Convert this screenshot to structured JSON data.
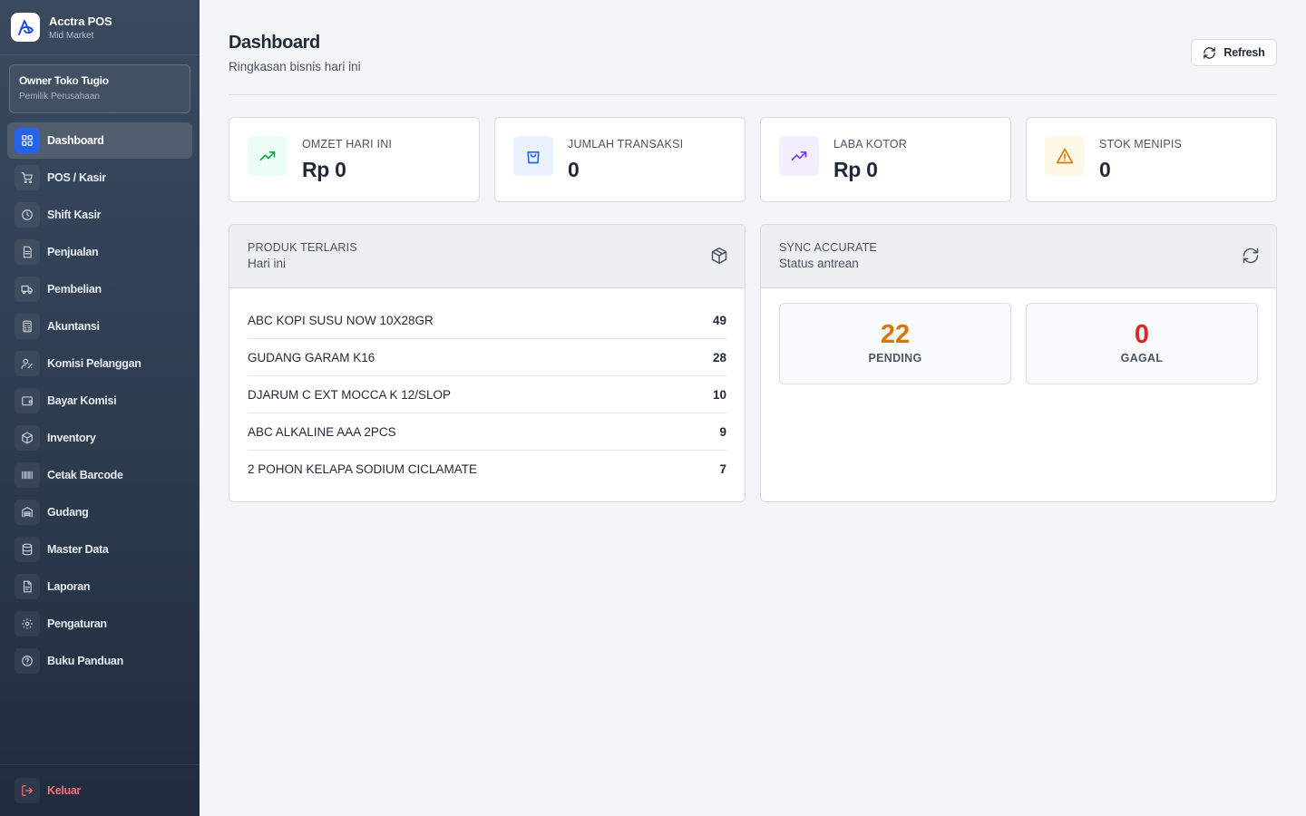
{
  "app": {
    "name": "Acctra POS",
    "plan": "Mid Market"
  },
  "user": {
    "name": "Owner Toko Tugio",
    "role": "Pemilik Perusahaan"
  },
  "sidebar": {
    "items": [
      {
        "label": "Dashboard",
        "icon": "grid-icon"
      },
      {
        "label": "POS / Kasir",
        "icon": "cart-icon"
      },
      {
        "label": "Shift Kasir",
        "icon": "clock-icon"
      },
      {
        "label": "Penjualan",
        "icon": "receipt-icon"
      },
      {
        "label": "Pembelian",
        "icon": "truck-icon"
      },
      {
        "label": "Akuntansi",
        "icon": "calculator-icon"
      },
      {
        "label": "Komisi Pelanggan",
        "icon": "user-commission-icon"
      },
      {
        "label": "Bayar Komisi",
        "icon": "wallet-icon"
      },
      {
        "label": "Inventory",
        "icon": "box-icon"
      },
      {
        "label": "Cetak Barcode",
        "icon": "barcode-icon"
      },
      {
        "label": "Gudang",
        "icon": "warehouse-icon"
      },
      {
        "label": "Master Data",
        "icon": "database-icon"
      },
      {
        "label": "Laporan",
        "icon": "report-icon"
      },
      {
        "label": "Pengaturan",
        "icon": "gear-icon"
      },
      {
        "label": "Buku Panduan",
        "icon": "help-icon"
      }
    ],
    "logout_label": "Keluar"
  },
  "header": {
    "title": "Dashboard",
    "subtitle": "Ringkasan bisnis hari ini",
    "refresh_label": "Refresh"
  },
  "stats": [
    {
      "label": "OMZET HARI INI",
      "value": "Rp 0",
      "icon": "trending-up-icon",
      "color": "#16a34a",
      "bg": "#ecfdf3"
    },
    {
      "label": "JUMLAH TRANSAKSI",
      "value": "0",
      "icon": "shopping-bag-icon",
      "color": "#2563eb",
      "bg": "#eaf2ff"
    },
    {
      "label": "LABA KOTOR",
      "value": "Rp 0",
      "icon": "trending-up-icon",
      "color": "#7c3aed",
      "bg": "#f3eefe"
    },
    {
      "label": "STOK MENIPIS",
      "value": "0",
      "icon": "warning-icon",
      "color": "#d97706",
      "bg": "#fff8e6"
    }
  ],
  "top_products": {
    "title": "PRODUK TERLARIS",
    "subtitle": "Hari ini",
    "items": [
      {
        "name": "ABC KOPI SUSU NOW 10X28GR",
        "qty": "49"
      },
      {
        "name": "GUDANG GARAM K16",
        "qty": "28"
      },
      {
        "name": "DJARUM C EXT MOCCA K 12/SLOP",
        "qty": "10"
      },
      {
        "name": "ABC ALKALINE AAA 2PCS",
        "qty": "9"
      },
      {
        "name": "2 POHON KELAPA SODIUM CICLAMATE",
        "qty": "7"
      }
    ]
  },
  "sync": {
    "title": "SYNC ACCURATE",
    "subtitle": "Status antrean",
    "pending": {
      "value": "22",
      "label": "PENDING",
      "color": "#d97706"
    },
    "failed": {
      "value": "0",
      "label": "GAGAL",
      "color": "#dc2626"
    }
  }
}
